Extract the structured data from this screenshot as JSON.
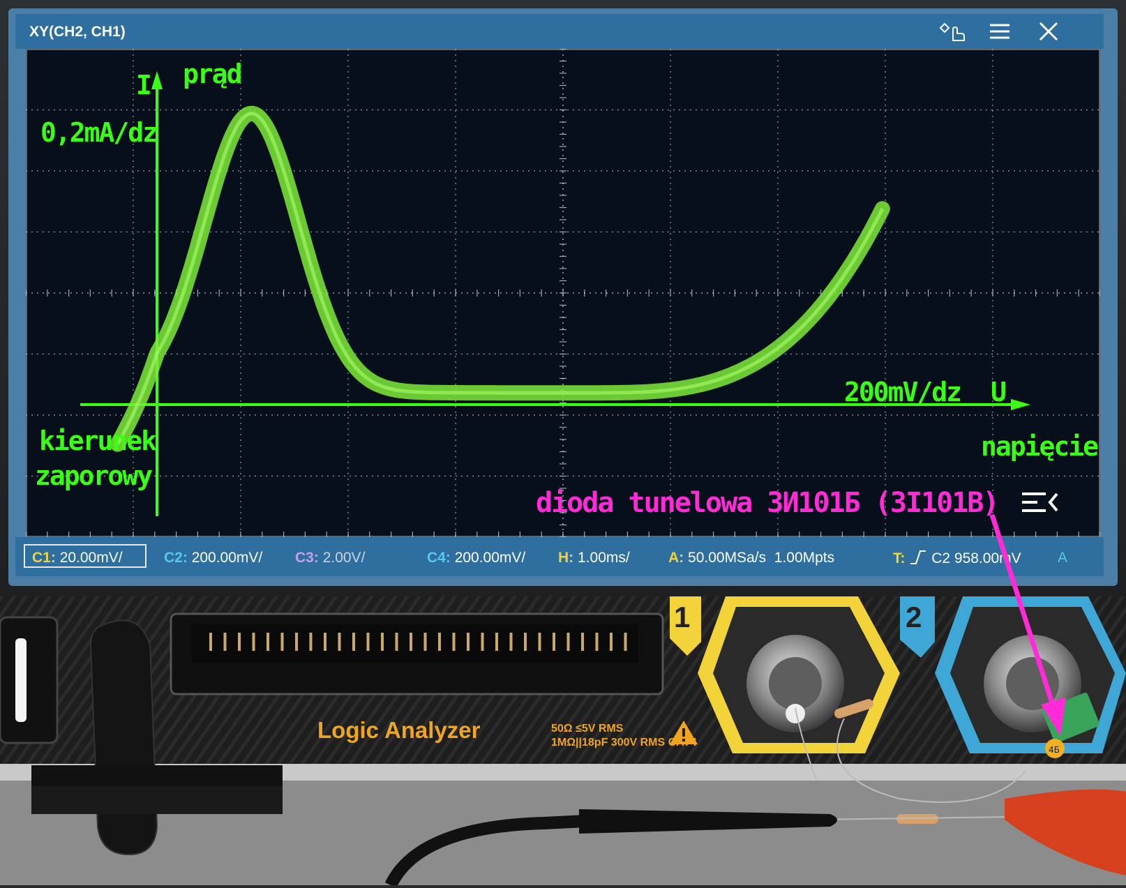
{
  "window": {
    "title": "XY(CH2, CH1)",
    "icons": [
      "pointer-hand-icon",
      "menu-icon",
      "close-icon"
    ]
  },
  "status": {
    "c1": {
      "label": "C1:",
      "value": "20.00mV/",
      "color": "#f2d33a"
    },
    "c2": {
      "label": "C2:",
      "value": "200.00mV/",
      "color": "#56c7f0"
    },
    "c3": {
      "label": "C3:",
      "value": "2.00V/",
      "color": "#c79cf5"
    },
    "c4": {
      "label": "C4:",
      "value": "200.00mV/",
      "color": "#56c7f0"
    },
    "h": {
      "label": "H:",
      "value": "1.00ms/",
      "color": "#f2d33a"
    },
    "a": {
      "label": "A:",
      "value": "50.00MSa/s",
      "points": "1.00Mpts",
      "color": "#f2d33a"
    },
    "t": {
      "label": "T:",
      "source": "C2",
      "level": "958.00mV",
      "mode": "A",
      "color": "#f2d33a"
    }
  },
  "annotations": {
    "y_symbol": "I",
    "y_name": "prąd",
    "y_scale": "0,2mA/dz",
    "x_scale": "200mV/dz",
    "x_symbol": "U",
    "x_name": "napięcie",
    "reverse_line1": "kierunek",
    "reverse_line2": "zaporowy",
    "device": "dioda tunelowa  3И101Б  (3I101B)"
  },
  "hardware": {
    "logic_analyzer_label": "Logic Analyzer",
    "spec_line1": "50Ω ≤5V RMS",
    "spec_line2": "1MΩ||18pF 300V RMS CAT I",
    "channel1": "1",
    "channel2": "2",
    "capacitor_marking": "4Б"
  },
  "colors": {
    "trace": "#7dea3a",
    "annotation": "#39ff14",
    "device_label": "#ff2bd6",
    "grid": "#c8d2da",
    "ui_blue": "#2f6fa0"
  }
}
